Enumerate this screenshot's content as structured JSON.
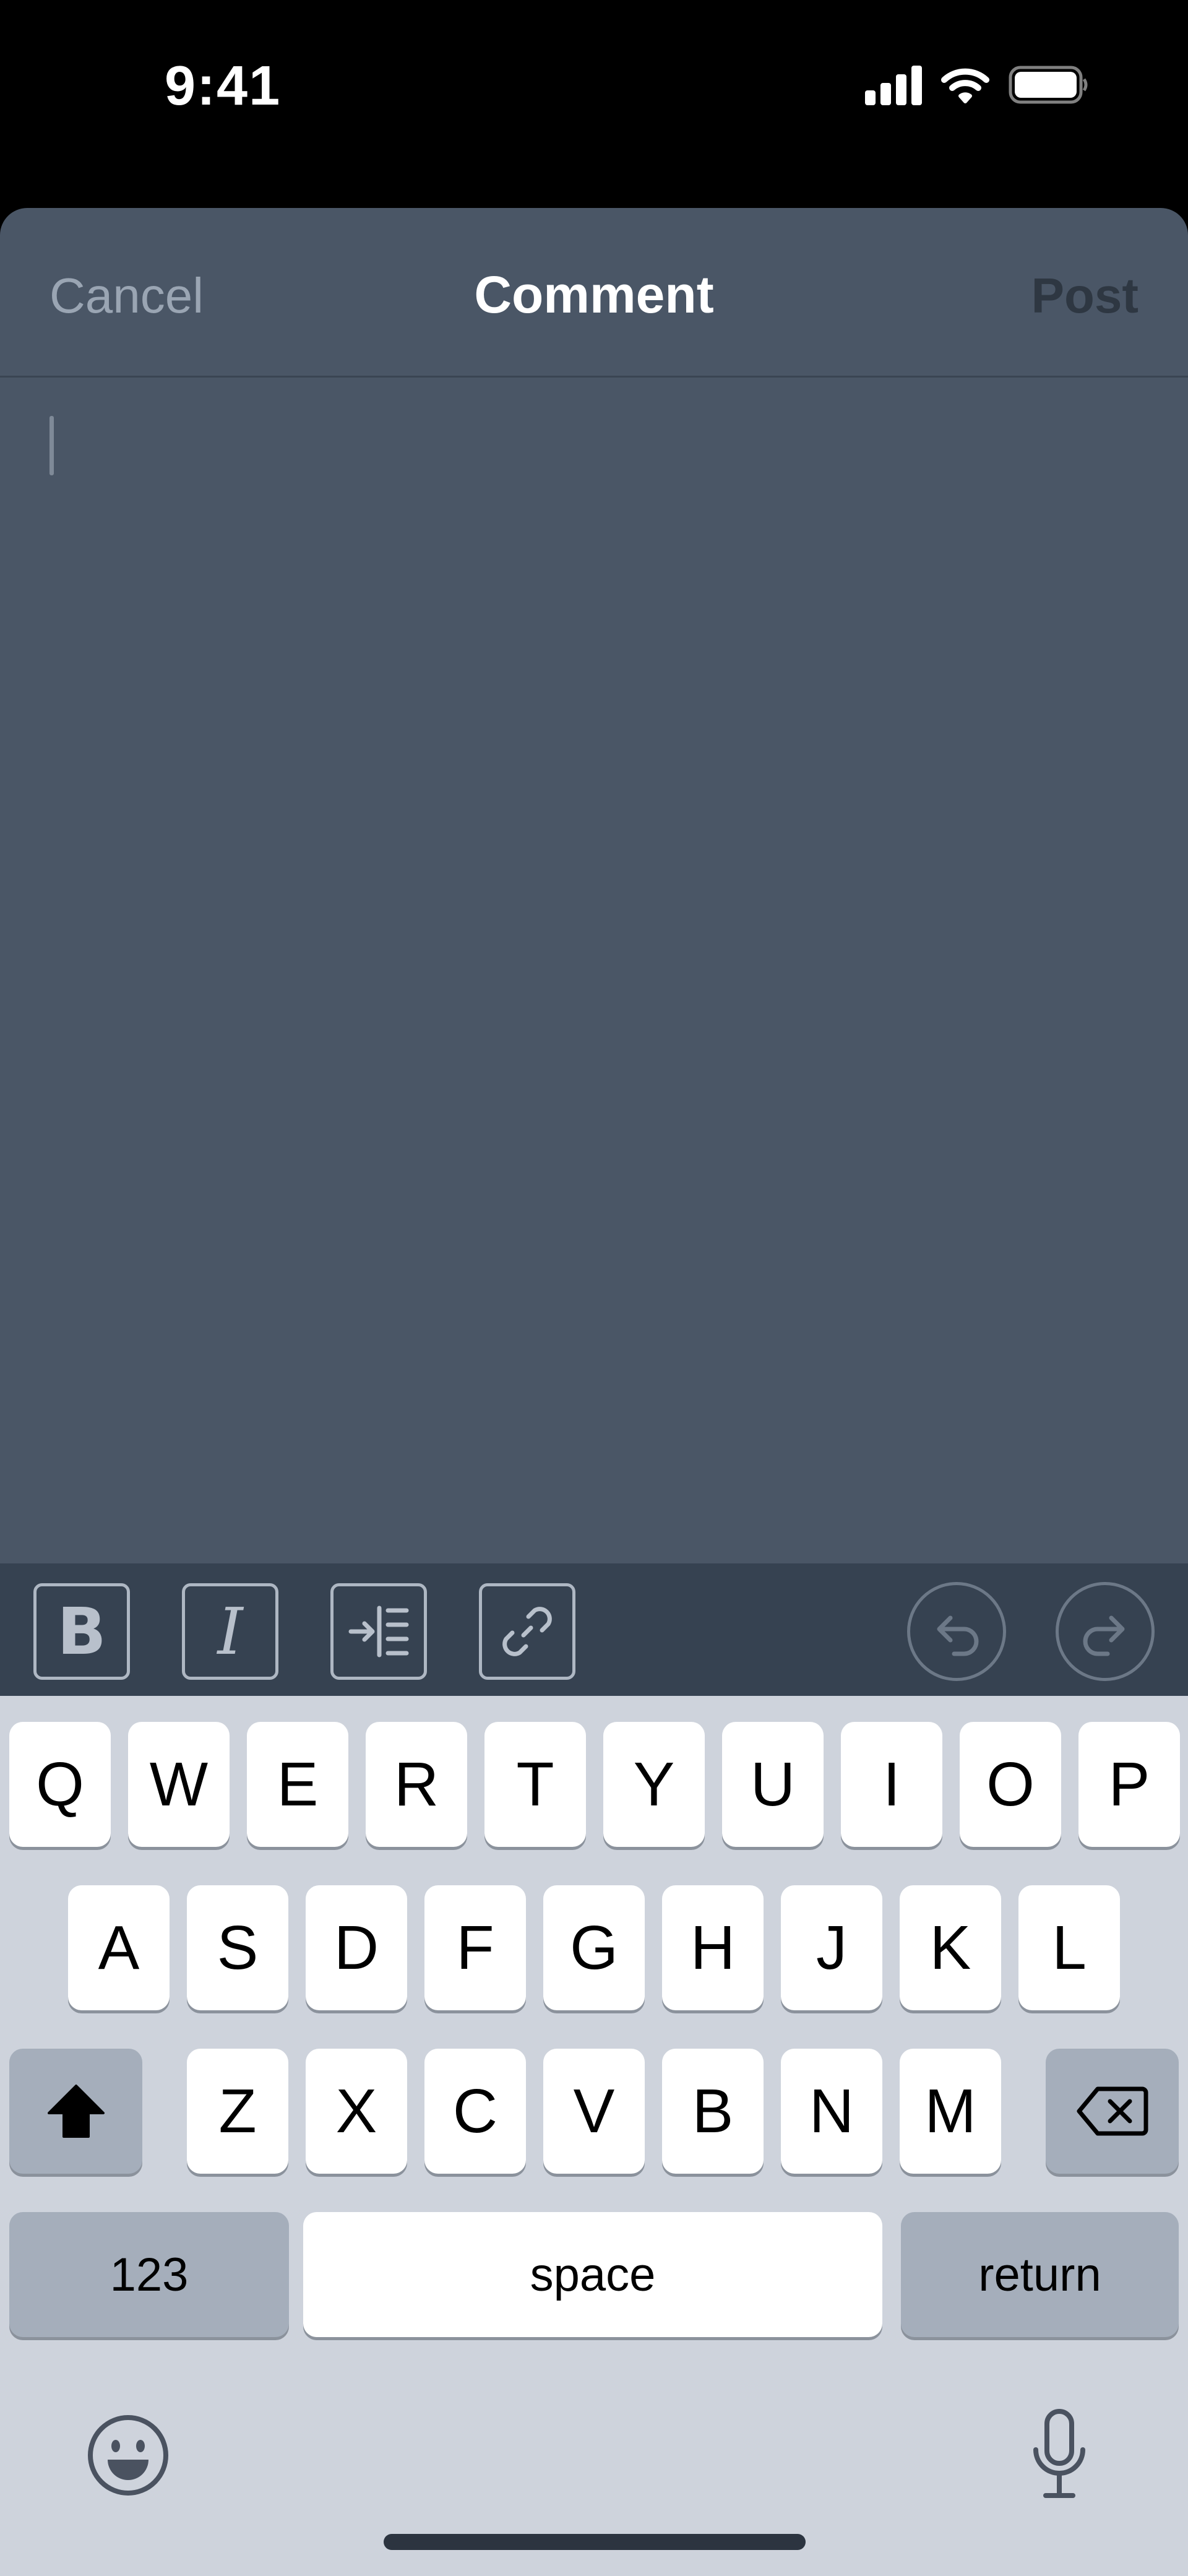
{
  "status_bar": {
    "time": "9:41",
    "signal_icon": "cellular-signal-icon",
    "wifi_icon": "wifi-icon",
    "battery_icon": "battery-icon"
  },
  "sheet": {
    "cancel_label": "Cancel",
    "title": "Comment",
    "post_label": "Post",
    "input_value": ""
  },
  "toolbar": {
    "items": [
      {
        "name": "bold",
        "icon": "bold-icon",
        "glyph": "B"
      },
      {
        "name": "italic",
        "icon": "italic-icon",
        "glyph": "I"
      },
      {
        "name": "indent",
        "icon": "indent-icon"
      },
      {
        "name": "link",
        "icon": "link-icon"
      },
      {
        "name": "undo",
        "icon": "undo-icon"
      },
      {
        "name": "redo",
        "icon": "redo-icon"
      }
    ]
  },
  "keyboard": {
    "row1": [
      "Q",
      "W",
      "E",
      "R",
      "T",
      "Y",
      "U",
      "I",
      "O",
      "P"
    ],
    "row2": [
      "A",
      "S",
      "D",
      "F",
      "G",
      "H",
      "J",
      "K",
      "L"
    ],
    "row3": [
      "Z",
      "X",
      "C",
      "V",
      "B",
      "N",
      "M"
    ],
    "numbers_label": "123",
    "space_label": "space",
    "return_label": "return",
    "shift_icon": "shift-icon",
    "delete_icon": "delete-icon",
    "emoji_icon": "emoji-icon",
    "mic_icon": "microphone-icon"
  },
  "colors": {
    "sheet_bg": "#4a5666",
    "toolbar_bg": "#364251",
    "keyboard_bg": "#ced3dc",
    "title_color": "#ffffff",
    "cancel_color": "#9aa5b3",
    "post_disabled_color": "#2e3742"
  }
}
